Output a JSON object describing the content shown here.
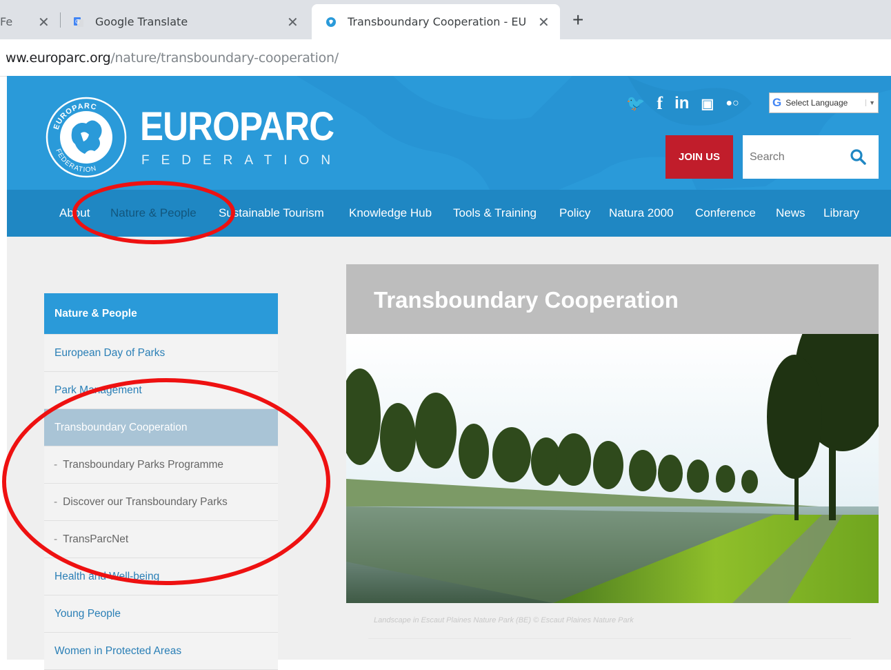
{
  "browser": {
    "tabs": [
      {
        "title": "Fe",
        "close": "✕"
      },
      {
        "title": "Google Translate",
        "close": "✕"
      },
      {
        "title": "Transboundary Cooperation - EU",
        "close": "✕"
      }
    ],
    "new_tab": "+",
    "url_host": "ww.europarc.org",
    "url_path": "/nature/transboundary-cooperation/"
  },
  "header": {
    "brand": "EUROPARC",
    "brand_sub": "FEDERATION",
    "logo_top_text": "EUROPARC",
    "logo_bottom_text": "FEDERATION",
    "social_icons": [
      "twitter-icon",
      "facebook-icon",
      "linkedin-icon",
      "youtube-icon",
      "flickr-icon"
    ],
    "social": {
      "twitter": "🐦",
      "facebook": "f",
      "linkedin": "in",
      "youtube": "▣",
      "flickr": "●○"
    },
    "language": {
      "g": "G",
      "label": "Select Language",
      "arrow": "▼"
    },
    "join": "JOIN US",
    "search_placeholder": "Search"
  },
  "nav": {
    "items": [
      "About",
      "Nature & People",
      "Sustainable Tourism",
      "Knowledge Hub",
      "Tools & Training",
      "Policy",
      "Natura 2000",
      "Conference",
      "News",
      "Library"
    ],
    "active": "Nature & People"
  },
  "sidebar": {
    "items": [
      {
        "label": "Nature & People"
      },
      {
        "label": "European Day of Parks"
      },
      {
        "label": "Park Management"
      },
      {
        "label": "Transboundary Cooperation"
      },
      {
        "label": "Transboundary Parks Programme"
      },
      {
        "label": "Discover our Transboundary Parks"
      },
      {
        "label": "TransParcNet"
      },
      {
        "label": "Health and Well-being"
      },
      {
        "label": "Young People"
      },
      {
        "label": "Women in Protected Areas"
      }
    ],
    "dash": "-"
  },
  "article": {
    "title": "Transboundary Cooperation",
    "caption": "Landscape in Escaut Plaines Nature Park (BE) © Escaut Plaines Nature Park"
  },
  "colors": {
    "header_blue": "#2a9ad9",
    "nav_blue": "#1f87c3",
    "join_red": "#c11d2b",
    "annotation_red": "#ee1111"
  }
}
